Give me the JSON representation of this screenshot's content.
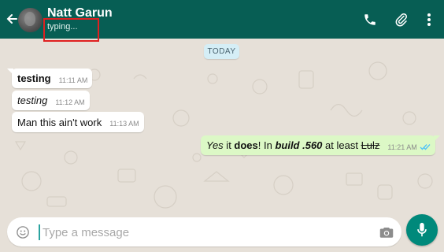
{
  "header": {
    "contact_name": "Natt Garun",
    "status": "typing...",
    "bar_color": "#075e54"
  },
  "date_chip": "TODAY",
  "messages": [
    {
      "direction": "in",
      "text": "testing",
      "style": "bold",
      "time": "11:11 AM"
    },
    {
      "direction": "in",
      "text": "testing",
      "style": "italic",
      "time": "11:12 AM"
    },
    {
      "direction": "in",
      "text": "Man this ain't work",
      "style": "plain",
      "time": "11:13 AM"
    },
    {
      "direction": "out",
      "segments": {
        "s1": "Yes",
        "s2": " it ",
        "s3": "does",
        "s4": "! In ",
        "s5": "build .560",
        "s6": " at least ",
        "s7": "Lulz"
      },
      "time": "11:21 AM",
      "ticks": "double-blue"
    }
  ],
  "composer": {
    "placeholder": "Type a message",
    "value": ""
  },
  "icons": {
    "back": "arrow-left-icon",
    "call": "phone-icon",
    "attach": "paperclip-icon",
    "menu": "more-vertical-icon",
    "emoji": "emoji-icon",
    "camera": "camera-icon",
    "mic": "microphone-icon"
  },
  "colors": {
    "incoming_bubble": "#ffffff",
    "outgoing_bubble": "#dcf8c6",
    "accent": "#00897b",
    "highlight_box": "#e02020"
  }
}
